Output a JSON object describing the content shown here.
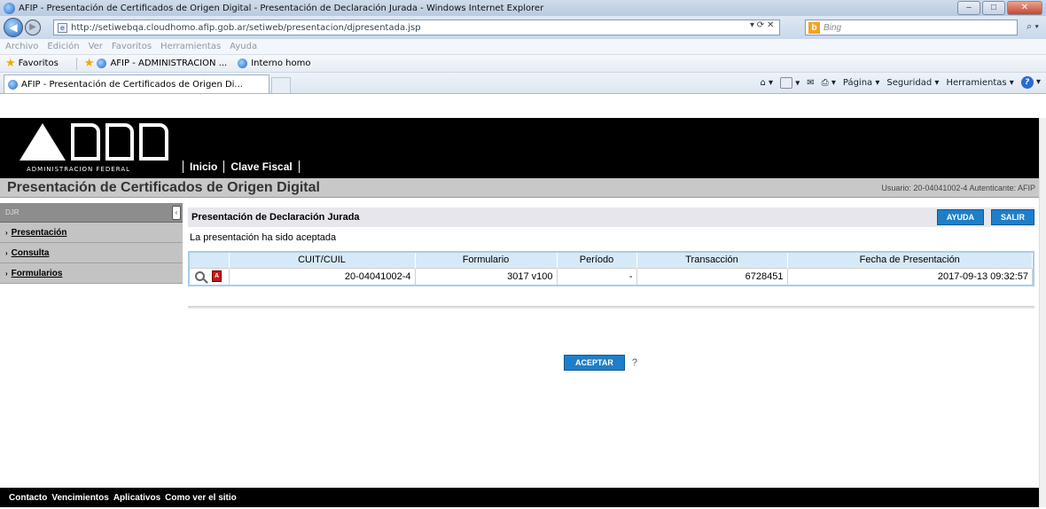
{
  "window": {
    "title": "AFIP - Presentación de Certificados de Origen Digital - Presentación de Declaración Jurada - Windows Internet Explorer",
    "min": "–",
    "max": "□",
    "close": "✕"
  },
  "browser": {
    "url": "http://setiwebqa.cloudhomo.afip.gob.ar/setiweb/presentacion/djpresentada.jsp",
    "search_placeholder": "Bing",
    "menu": [
      "Archivo",
      "Edición",
      "Ver",
      "Favoritos",
      "Herramientas",
      "Ayuda"
    ],
    "favorites_label": "Favoritos",
    "favorites": [
      "AFIP - ADMINISTRACION ...",
      "Interno homo"
    ],
    "tab_title": "AFIP - Presentación de Certificados de Origen Di...",
    "commands": {
      "page": "Página ▾",
      "security": "Seguridad ▾",
      "tools": "Herramientas ▾"
    }
  },
  "header": {
    "logo_sub": "ADMINISTRACION FEDERAL",
    "nav": [
      "Inicio",
      "Clave Fiscal"
    ],
    "system_title": "Presentación de Certificados de Origen Digital",
    "user_info": "Usuario: 20-04041002-4 Autenticante: AFIP"
  },
  "sidebar": {
    "head": "DJR",
    "items": [
      "Presentación",
      "Consulta",
      "Formularios"
    ]
  },
  "main": {
    "section_title": "Presentación de Declaración Jurada",
    "help_button": "AYUDA",
    "exit_button": "SALIR",
    "message": "La presentación ha sido aceptada",
    "table": {
      "headers": [
        "CUIT/CUIL",
        "Formulario",
        "Período",
        "Transacción",
        "Fecha de Presentación"
      ],
      "rows": [
        {
          "cuit": "20-04041002-4",
          "formulario": "3017 v100",
          "periodo": "-",
          "transaccion": "6728451",
          "fecha": "2017-09-13 09:32:57"
        }
      ]
    },
    "accept_button": "ACEPTAR",
    "help_mark": "?"
  },
  "footer": {
    "links": [
      "Contacto",
      "Vencimientos",
      "Aplicativos",
      "Como ver el sitio"
    ]
  }
}
